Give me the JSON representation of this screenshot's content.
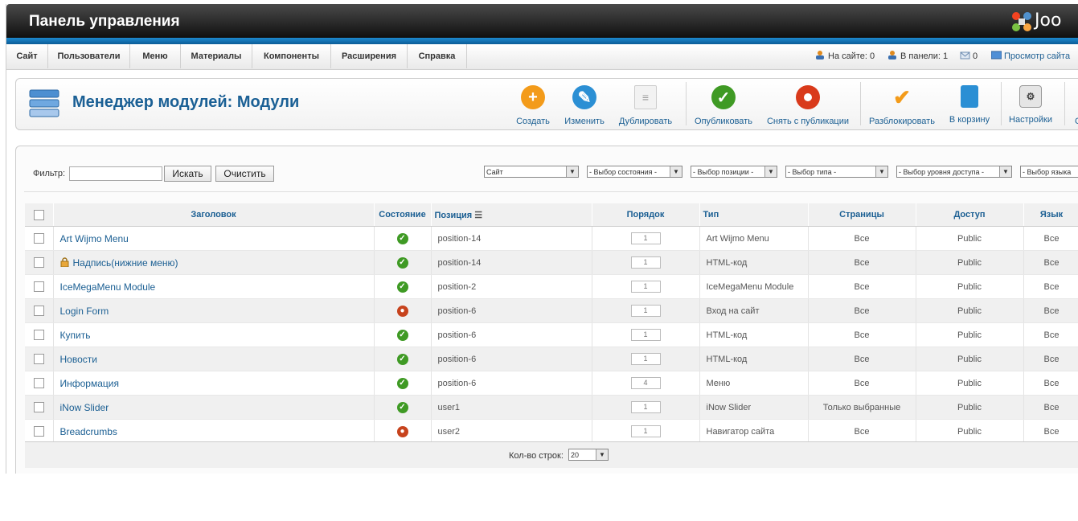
{
  "header": {
    "title": "Панель управления",
    "logo_text": "Joo"
  },
  "menu": [
    {
      "label": "Сайт"
    },
    {
      "label": "Пользователи"
    },
    {
      "label": "Меню"
    },
    {
      "label": "Материалы"
    },
    {
      "label": "Компоненты"
    },
    {
      "label": "Расширения"
    },
    {
      "label": "Справка"
    }
  ],
  "status": {
    "on_site": "На сайте: 0",
    "in_panel": "В панели: 1",
    "messages": "0",
    "preview": "Просмотр сайта"
  },
  "page": {
    "title": "Менеджер модулей: Модули"
  },
  "toolbar": {
    "create": "Создать",
    "edit": "Изменить",
    "duplicate": "Дублировать",
    "publish": "Опубликовать",
    "unpublish": "Снять с публикации",
    "checkin": "Разблокировать",
    "trash": "В корзину",
    "options": "Настройки",
    "help_partial": "С"
  },
  "filter": {
    "label": "Фильтр:",
    "value": "",
    "search_button": "Искать",
    "clear_button": "Очистить",
    "client_select": "Сайт",
    "state_select": "- Выбор состояния -",
    "position_select": "- Выбор позиции -",
    "type_select": "- Выбор типа -",
    "access_select": "- Выбор уровня доступа -",
    "language_select": "- Выбор языка"
  },
  "columns": {
    "title": "Заголовок",
    "state": "Состояние",
    "position": "Позиция",
    "order": "Порядок",
    "type": "Тип",
    "pages": "Страницы",
    "access": "Доступ",
    "language": "Язык"
  },
  "rows": [
    {
      "title": "Art Wijmo Menu",
      "state": "published",
      "position": "position-14",
      "order": "1",
      "type": "Art Wijmo Menu",
      "pages": "Все",
      "access": "Public",
      "language": "Все",
      "locked": false
    },
    {
      "title": "Надпись(нижние меню)",
      "state": "published",
      "position": "position-14",
      "order": "1",
      "type": "HTML-код",
      "pages": "Все",
      "access": "Public",
      "language": "Все",
      "locked": true
    },
    {
      "title": "IceMegaMenu Module",
      "state": "published",
      "position": "position-2",
      "order": "1",
      "type": "IceMegaMenu Module",
      "pages": "Все",
      "access": "Public",
      "language": "Все",
      "locked": false
    },
    {
      "title": "Login Form",
      "state": "unpublished",
      "position": "position-6",
      "order": "1",
      "type": "Вход на сайт",
      "pages": "Все",
      "access": "Public",
      "language": "Все",
      "locked": false
    },
    {
      "title": "Купить",
      "state": "published",
      "position": "position-6",
      "order": "1",
      "type": "HTML-код",
      "pages": "Все",
      "access": "Public",
      "language": "Все",
      "locked": false
    },
    {
      "title": "Новости",
      "state": "published",
      "position": "position-6",
      "order": "1",
      "type": "HTML-код",
      "pages": "Все",
      "access": "Public",
      "language": "Все",
      "locked": false
    },
    {
      "title": "Информация",
      "state": "published",
      "position": "position-6",
      "order": "4",
      "type": "Меню",
      "pages": "Все",
      "access": "Public",
      "language": "Все",
      "locked": false
    },
    {
      "title": "iNow Slider",
      "state": "published",
      "position": "user1",
      "order": "1",
      "type": "iNow Slider",
      "pages": "Только выбранные",
      "access": "Public",
      "language": "Все",
      "locked": false
    },
    {
      "title": "Breadcrumbs",
      "state": "unpublished",
      "position": "user2",
      "order": "1",
      "type": "Навигатор сайта",
      "pages": "Все",
      "access": "Public",
      "language": "Все",
      "locked": false
    }
  ],
  "pagination": {
    "label": "Кол-во строк:",
    "limit": "20"
  },
  "colors": {
    "link": "#1b5f93",
    "published": "#3f9a24",
    "unpublished": "#c7431d",
    "accent_bar": "#1d8ad0"
  }
}
